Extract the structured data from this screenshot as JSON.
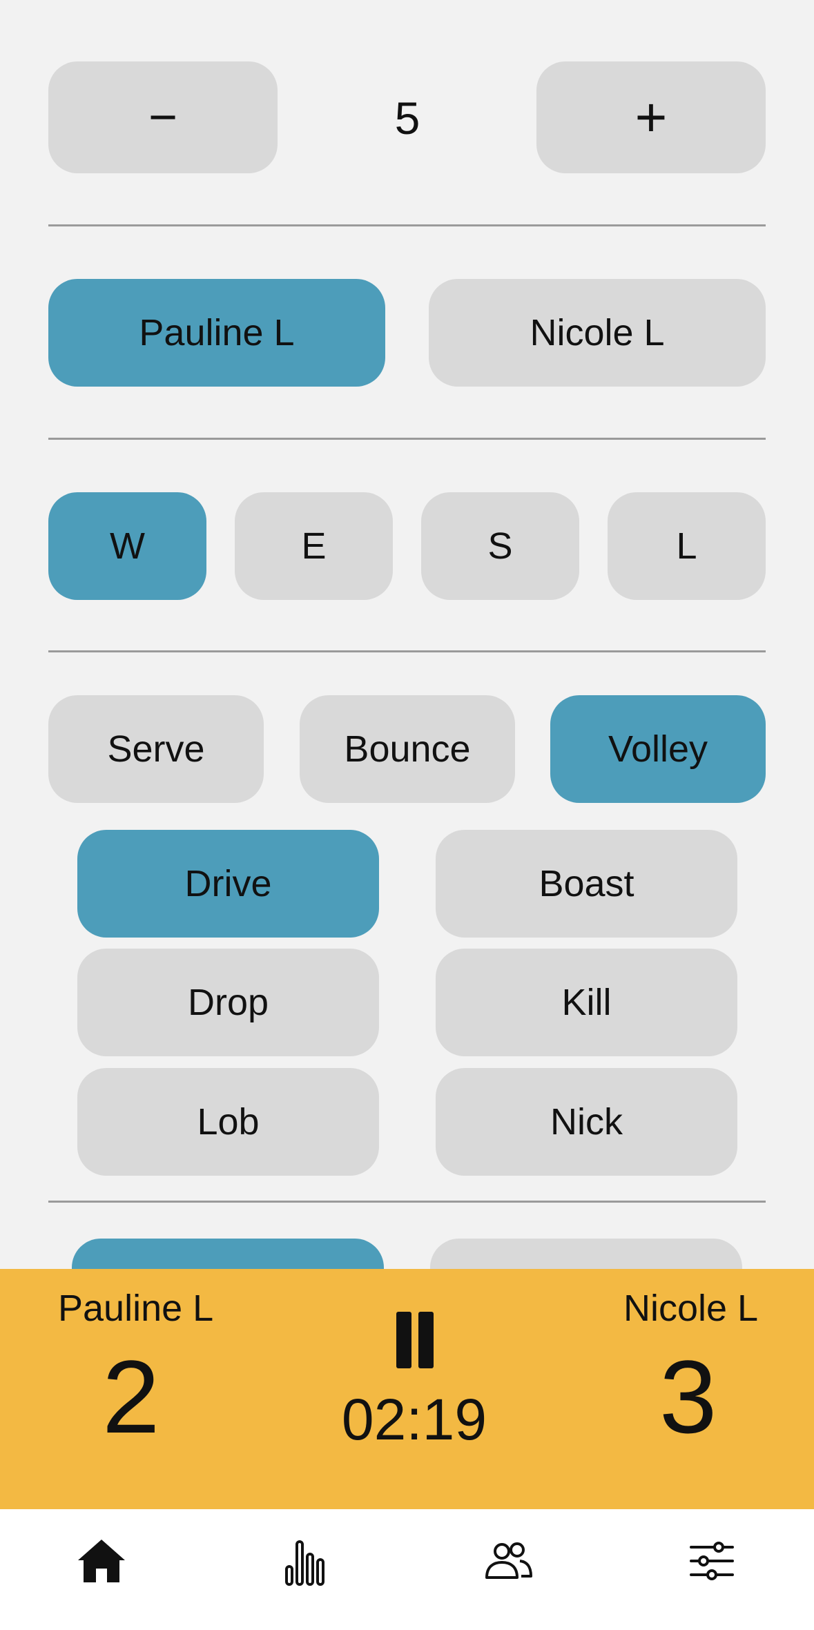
{
  "counter": {
    "decrement_symbol": "−",
    "value": "5",
    "increment_symbol": "+"
  },
  "players": [
    "Pauline L",
    "Nicole L"
  ],
  "zones": [
    "W",
    "E",
    "S",
    "L"
  ],
  "shot_types": [
    "Serve",
    "Bounce",
    "Volley"
  ],
  "shots": [
    "Drive",
    "Boast",
    "Drop",
    "Kill",
    "Lob",
    "Nick"
  ],
  "scoreboard": {
    "left_name": "Pauline L",
    "left_score": "2",
    "right_name": "Nicole L",
    "right_score": "3",
    "timer": "02:19",
    "state_icon": "pause-icon"
  },
  "tabs": [
    {
      "icon": "home-icon"
    },
    {
      "icon": "stats-icon"
    },
    {
      "icon": "players-icon"
    },
    {
      "icon": "settings-icon"
    }
  ],
  "colors": {
    "selected": "#4d9dba",
    "unselected": "#d9d9d9",
    "scoreboard": "#f3b943",
    "background": "#f2f2f2"
  }
}
